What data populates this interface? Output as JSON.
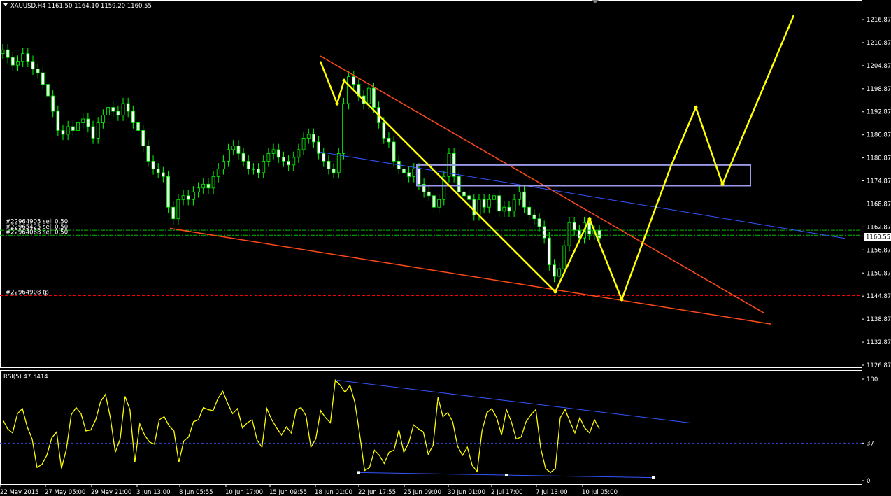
{
  "window": {
    "symbol_header": "XAUUSD,H4  1161.50 1164.10 1159.20 1160.55"
  },
  "chart_data": [
    {
      "type": "candlestick",
      "title": "XAUUSD,H4",
      "ohlc_last": {
        "open": 1161.5,
        "high": 1164.1,
        "low": 1159.2,
        "close": 1160.55
      },
      "current_price": "1160.55",
      "ylim": [
        1126.87,
        1216.87
      ],
      "y_ticks": [
        "1216.87",
        "1210.87",
        "1204.87",
        "1198.87",
        "1192.87",
        "1186.87",
        "1180.87",
        "1174.87",
        "1168.87",
        "1162.87",
        "1156.87",
        "1150.87",
        "1144.87",
        "1138.87",
        "1132.87",
        "1126.87"
      ],
      "x_ticks": [
        "22 May 2015",
        "27 May 05:00",
        "29 May 21:00",
        "3 Jun 13:00",
        "8 Jun 05:55",
        "10 Jun 17:00",
        "15 Jun 09:55",
        "18 Jun 01:00",
        "22 Jun 17:55",
        "25 Jun 09:00",
        "30 Jun 01:00",
        "2 Jul 17:00",
        "7 Jul 13:00",
        "10 Jul 05:00"
      ],
      "trade_lines": [
        {
          "label": "#22964905 sell 0.50",
          "price": 1163.4
        },
        {
          "label": "#22965425 sell 0.50",
          "price": 1162.0
        },
        {
          "label": "#22964068 sell 0.50",
          "price": 1160.7
        },
        {
          "label": "#22964908 tp",
          "price": 1145.0
        }
      ],
      "close_series": [
        1209,
        1207,
        1205,
        1206,
        1208,
        1206,
        1204,
        1203,
        1200,
        1197,
        1193,
        1188,
        1187,
        1189,
        1188,
        1190,
        1191,
        1189,
        1186,
        1190,
        1192,
        1194,
        1193,
        1192,
        1195,
        1193,
        1190,
        1188,
        1184,
        1180,
        1178,
        1177,
        1176,
        1168,
        1165,
        1170,
        1171,
        1170,
        1172,
        1173,
        1174,
        1173,
        1176,
        1178,
        1180,
        1183,
        1184,
        1182,
        1180,
        1178,
        1178,
        1177,
        1180,
        1182,
        1183,
        1181,
        1180,
        1179,
        1181,
        1183,
        1186,
        1187,
        1185,
        1182,
        1180,
        1178,
        1177,
        1182,
        1195,
        1202,
        1200,
        1197,
        1195,
        1199,
        1194,
        1190,
        1186,
        1185,
        1180,
        1178,
        1177,
        1176,
        1178,
        1174,
        1172,
        1171,
        1168,
        1170,
        1176,
        1182,
        1176,
        1172,
        1171,
        1170,
        1166,
        1170,
        1168,
        1170,
        1171,
        1167,
        1168,
        1167,
        1170,
        1172,
        1168,
        1166,
        1165,
        1163,
        1160,
        1153,
        1150,
        1152,
        1158,
        1164,
        1162,
        1160,
        1164,
        1161,
        1162,
        1160
      ]
    },
    {
      "type": "line",
      "title": "RSI(5) 47.5414",
      "ylim": [
        0,
        100
      ],
      "y_ticks": [
        "100",
        "37",
        "0"
      ],
      "series": [
        {
          "name": "RSI(5)",
          "values": [
            60,
            51,
            47,
            66,
            71,
            53,
            41,
            13,
            16,
            25,
            42,
            48,
            12,
            31,
            65,
            72,
            66,
            49,
            50,
            60,
            78,
            85,
            62,
            28,
            41,
            83,
            70,
            18,
            56,
            45,
            38,
            36,
            60,
            63,
            54,
            49,
            18,
            39,
            43,
            58,
            60,
            72,
            70,
            69,
            81,
            88,
            76,
            66,
            71,
            52,
            57,
            60,
            40,
            33,
            71,
            60,
            52,
            45,
            53,
            47,
            70,
            72,
            64,
            33,
            41,
            69,
            62,
            57,
            99,
            94,
            87,
            94,
            77,
            45,
            10,
            13,
            30,
            25,
            17,
            28,
            30,
            50,
            28,
            37,
            55,
            51,
            48,
            26,
            35,
            82,
            63,
            67,
            58,
            34,
            25,
            33,
            15,
            9,
            49,
            67,
            71,
            62,
            45,
            70,
            58,
            41,
            43,
            58,
            65,
            70,
            32,
            12,
            8,
            12,
            62,
            70,
            58,
            47,
            62,
            52,
            47,
            60,
            51
          ]
        }
      ]
    }
  ]
}
